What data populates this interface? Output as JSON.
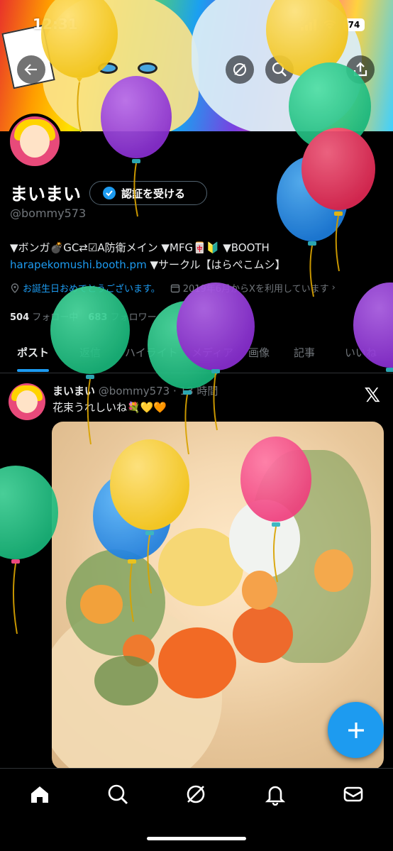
{
  "status": {
    "time": "12:31",
    "battery": "74"
  },
  "profile": {
    "display_name": "まいまい",
    "verify_label": "認証を受ける",
    "handle": "@bommy573",
    "bio_line1": "▼ボンガ💣GC⇄☑A防衛メイン ▼MFG🀄🔰 ▼BOOTH",
    "bio_link": "harapekomushi.booth.pm",
    "bio_line2_rest": " ▼サークル【はらぺこムシ】",
    "birthday_text": "お誕生日おめでとうございます。",
    "joined_text": "2019年6月からXを利用しています",
    "following_count": "504",
    "following_label": "フォロー中",
    "followers_count": "683",
    "followers_label": "フォロワー"
  },
  "tabs": [
    {
      "label": "ポスト"
    },
    {
      "label": "返信"
    },
    {
      "label": "ハイライト"
    },
    {
      "label": "メディア"
    },
    {
      "label": "画像"
    },
    {
      "label": "記事"
    },
    {
      "label": "いいね"
    }
  ],
  "post": {
    "author": "まいまい",
    "handle": "@bommy573",
    "time": "· 13 時間",
    "text": "花束うれしいね💐💛🧡"
  },
  "colors": {
    "accent": "#1d9bf0",
    "background": "#000000",
    "muted": "#71767b"
  },
  "icons": {
    "back": "arrow-left-icon",
    "grok": "grok-icon",
    "search": "search-icon",
    "share": "share-icon",
    "compose": "plus-icon",
    "home": "home-icon",
    "explore": "search-icon",
    "bell": "bell-icon",
    "mail": "mail-icon"
  }
}
